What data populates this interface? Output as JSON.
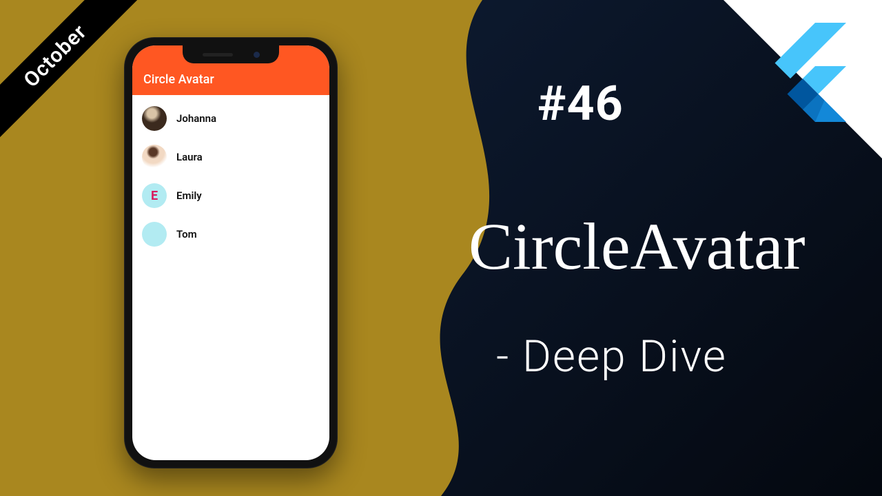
{
  "ribbon": {
    "label": "October"
  },
  "episode": "#46",
  "title": "CircleAvatar",
  "subtitle": "- Deep Dive",
  "app": {
    "appbar_title": "Circle Avatar",
    "contacts": [
      {
        "name": "Johanna",
        "avatar_type": "photo1",
        "letter": ""
      },
      {
        "name": "Laura",
        "avatar_type": "photo2",
        "letter": ""
      },
      {
        "name": "Emily",
        "avatar_type": "letter",
        "letter": "E"
      },
      {
        "name": "Tom",
        "avatar_type": "blank",
        "letter": ""
      }
    ]
  },
  "logo": {
    "name": "flutter-logo"
  }
}
